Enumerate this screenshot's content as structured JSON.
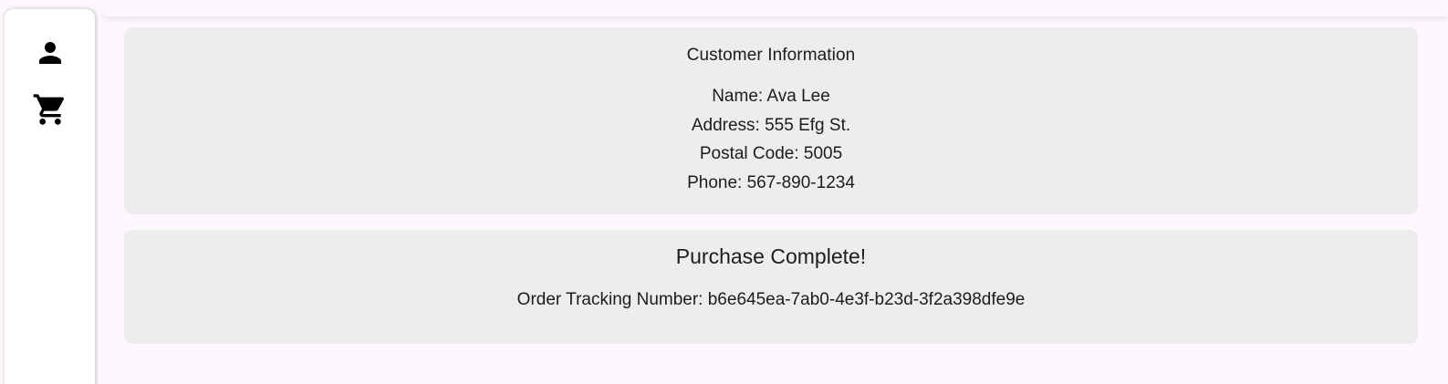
{
  "nav": {
    "items": [
      {
        "icon": "person-icon",
        "label": "Customer"
      },
      {
        "icon": "shopping-cart-icon",
        "label": "Cart"
      }
    ]
  },
  "customer": {
    "title": "Customer Information",
    "name": "Name: Ava Lee",
    "address": "Address: 555 Efg St.",
    "postal_code": "Postal Code: 5005",
    "phone": "Phone: 567-890-1234"
  },
  "purchase": {
    "title": "Purchase Complete!",
    "tracking": "Order Tracking Number: b6e645ea-7ab0-4e3f-b23d-3f2a398dfe9e"
  },
  "colors": {
    "background": "#fdf8fd",
    "card": "#eeedee",
    "rail": "#ffffff",
    "text": "#1c1b1f"
  }
}
